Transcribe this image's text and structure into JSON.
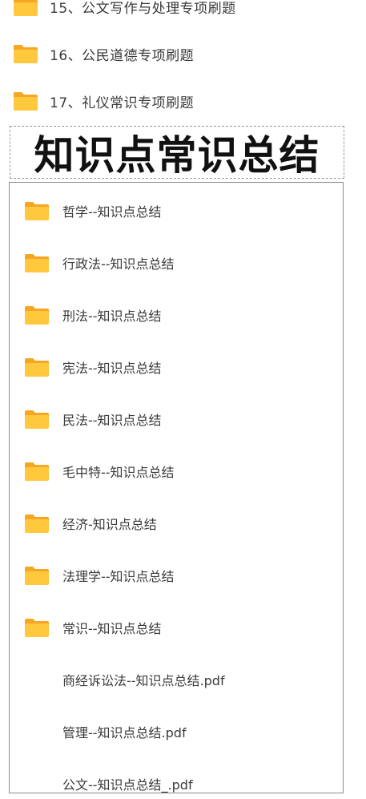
{
  "top_items": [
    {
      "label": "15、公文写作与处理专项刷题",
      "icon": "folder-icon"
    },
    {
      "label": "16、公民道德专项刷题",
      "icon": "folder-icon"
    },
    {
      "label": "17、礼仪常识专项刷题",
      "icon": "folder-icon"
    }
  ],
  "heading": "知识点常识总结",
  "items": [
    {
      "label": "哲学--知识点总结",
      "icon": "folder-icon"
    },
    {
      "label": "行政法--知识点总结",
      "icon": "folder-icon"
    },
    {
      "label": "刑法--知识点总结",
      "icon": "folder-icon"
    },
    {
      "label": "宪法--知识点总结",
      "icon": "folder-icon"
    },
    {
      "label": "民法--知识点总结",
      "icon": "folder-icon"
    },
    {
      "label": "毛中特--知识点总结",
      "icon": "folder-icon"
    },
    {
      "label": "经济-知识点总结",
      "icon": "folder-icon"
    },
    {
      "label": "法理学--知识点总结",
      "icon": "folder-icon"
    },
    {
      "label": "常识--知识点总结",
      "icon": "folder-icon"
    },
    {
      "label": "商经诉讼法--知识点总结.pdf",
      "icon": "pdf-file"
    },
    {
      "label": "管理--知识点总结.pdf",
      "icon": "pdf-file"
    },
    {
      "label": "公文--知识点总结_.pdf",
      "icon": "pdf-file"
    }
  ],
  "colors": {
    "folder_body": "#FFC83D",
    "folder_tab": "#F5A623",
    "text": "#3a3a3a",
    "heading": "#111111"
  }
}
